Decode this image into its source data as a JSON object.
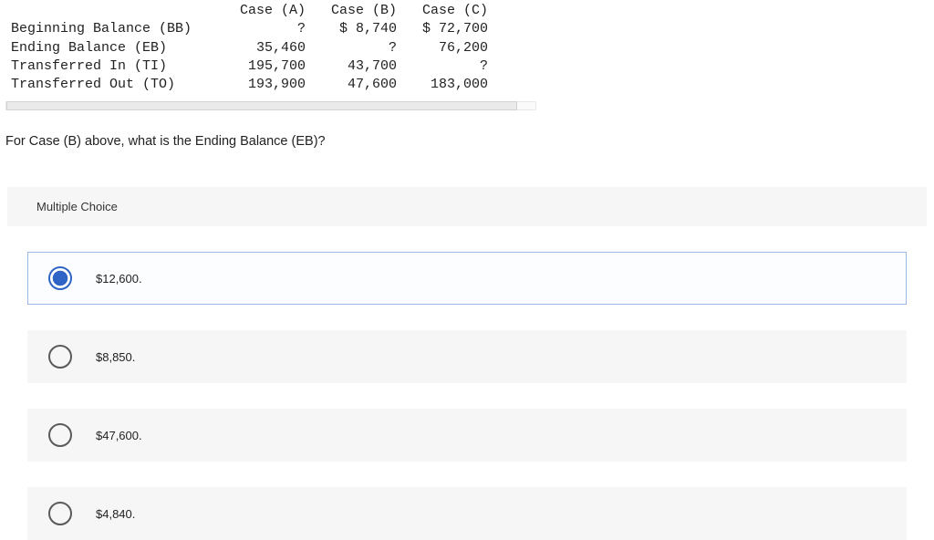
{
  "table": {
    "headers": [
      "Case (A)",
      "Case (B)",
      "Case (C)"
    ],
    "rows": [
      {
        "label": "Beginning Balance (BB)",
        "a": "?",
        "b": "$ 8,740",
        "c": "$ 72,700"
      },
      {
        "label": "Ending Balance (EB)",
        "a": "35,460",
        "b": "?",
        "c": "76,200"
      },
      {
        "label": "Transferred In (TI)",
        "a": "195,700",
        "b": "43,700",
        "c": "?"
      },
      {
        "label": "Transferred Out (TO)",
        "a": "193,900",
        "b": "47,600",
        "c": "183,000"
      }
    ]
  },
  "question": "For Case (B) above, what is the Ending Balance (EB)?",
  "mc_title": "Multiple Choice",
  "options": [
    {
      "text": "$12,600.",
      "selected": true
    },
    {
      "text": "$8,850.",
      "selected": false
    },
    {
      "text": "$47,600.",
      "selected": false
    },
    {
      "text": "$4,840.",
      "selected": false
    }
  ],
  "chart_data": {
    "type": "table",
    "title": "Case balances",
    "columns": [
      "",
      "Case (A)",
      "Case (B)",
      "Case (C)"
    ],
    "rows": [
      [
        "Beginning Balance (BB)",
        null,
        8740,
        72700
      ],
      [
        "Ending Balance (EB)",
        35460,
        null,
        76200
      ],
      [
        "Transferred In (TI)",
        195700,
        43700,
        null
      ],
      [
        "Transferred Out (TO)",
        193900,
        47600,
        183000
      ]
    ]
  }
}
